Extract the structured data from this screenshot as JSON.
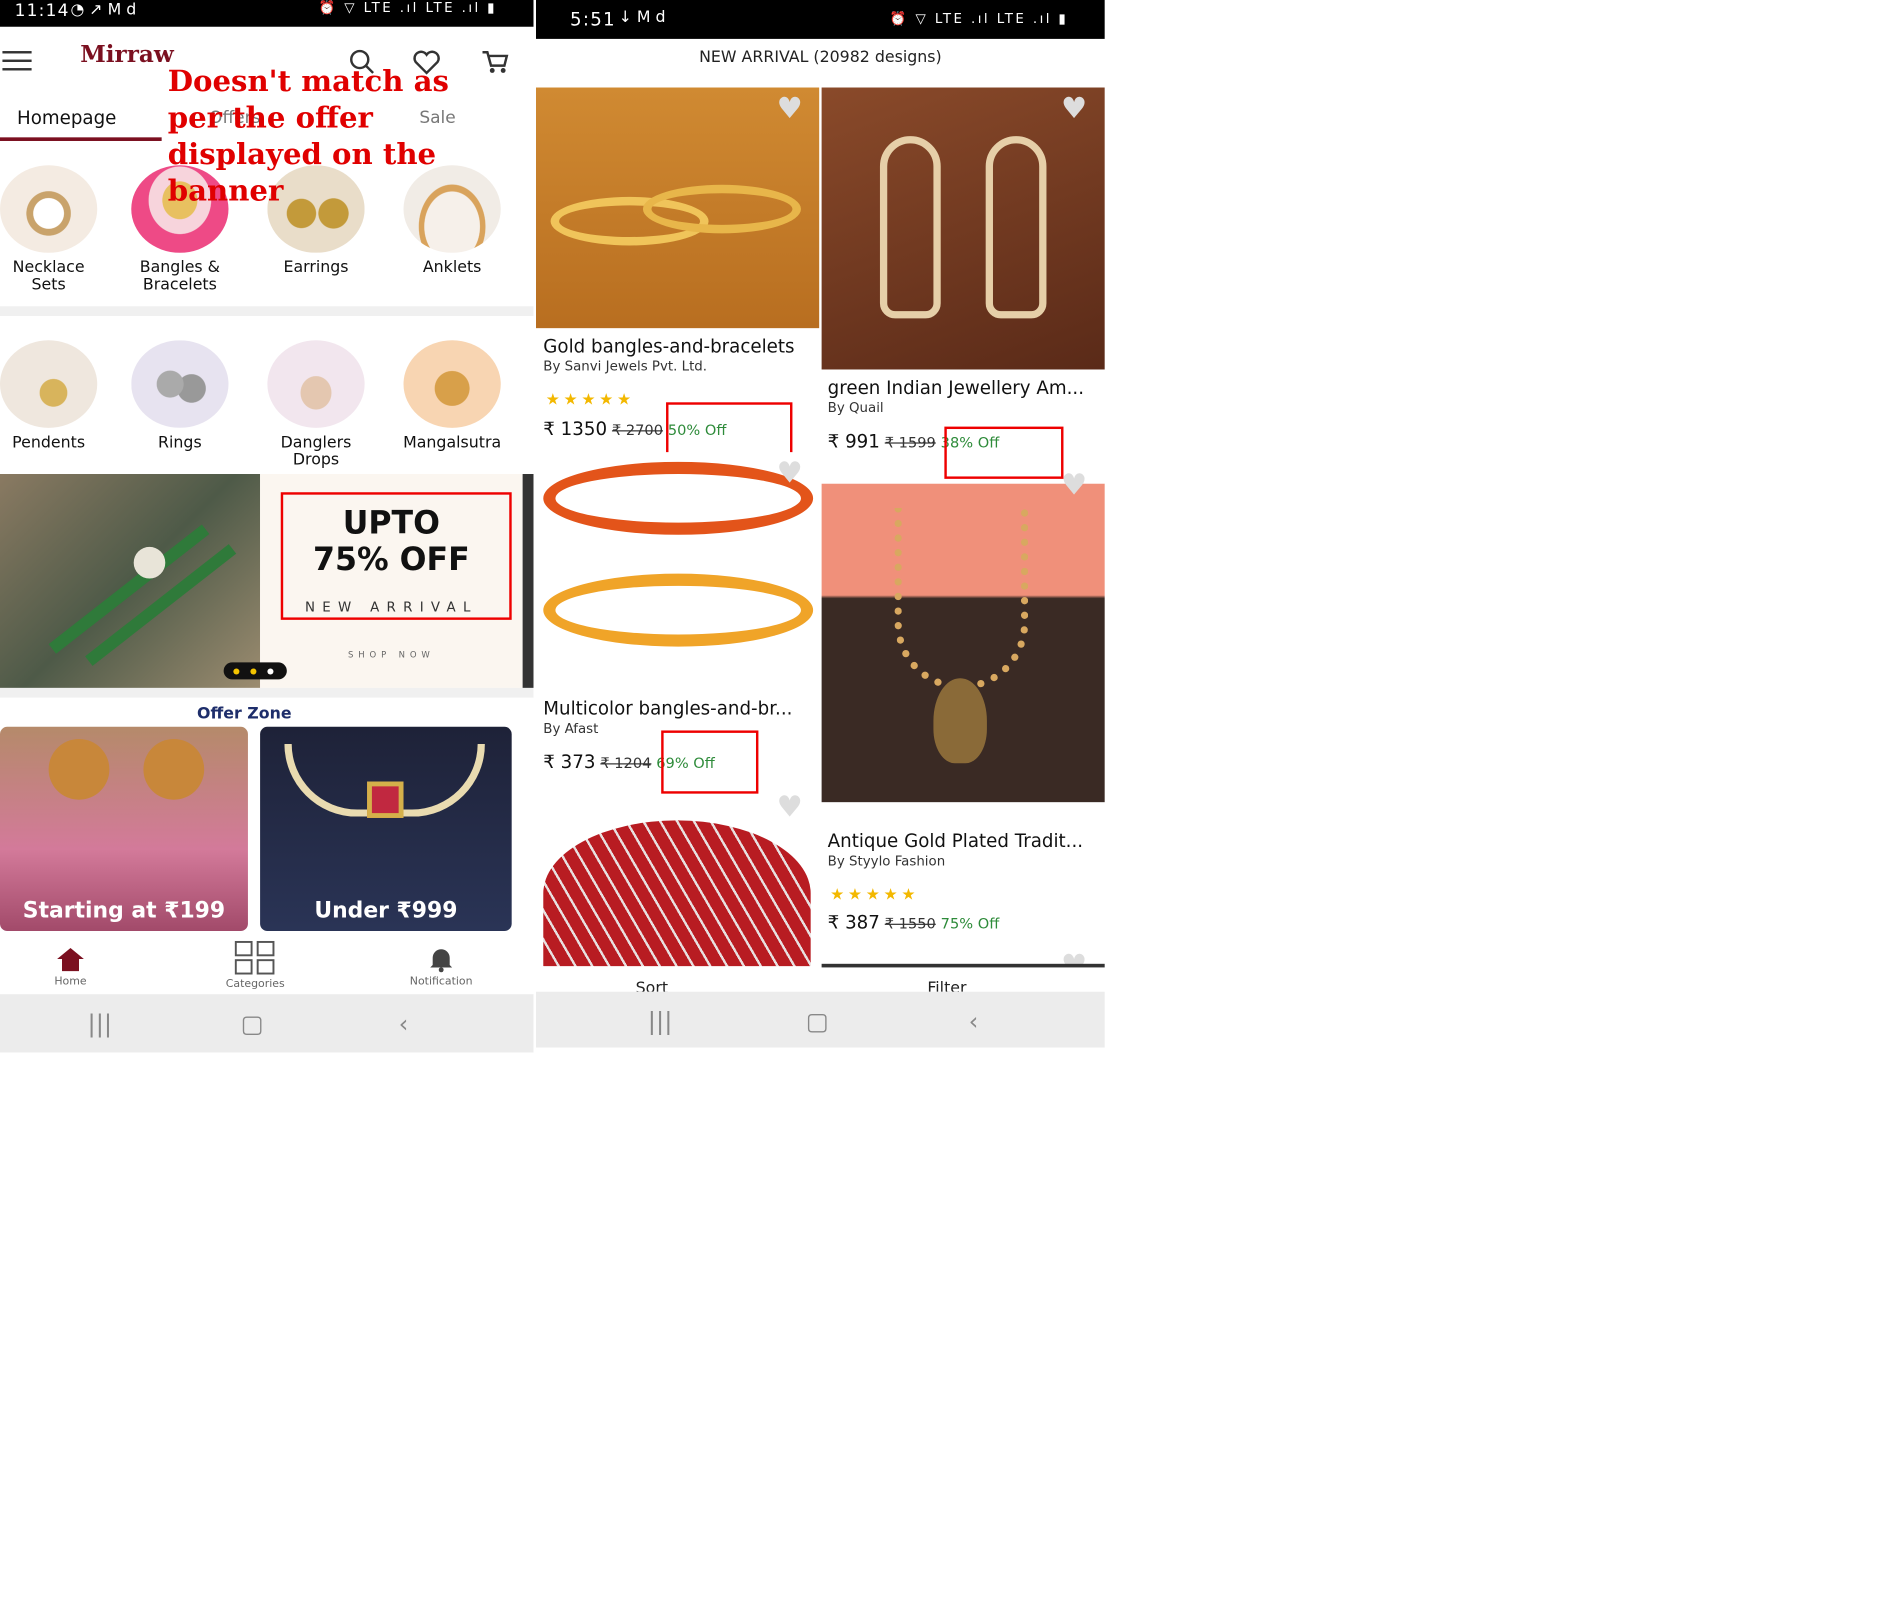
{
  "annotation": {
    "text": "Doesn't match as per the offer displayed on the banner"
  },
  "left_phone": {
    "status_time": "11:14",
    "status_icons": "◔ ↗ M d",
    "status_right": "⏰ ▽ LTE .ıl LTE .ıl ▮",
    "logo": "Mirraw",
    "tabs": {
      "homepage": "Homepage",
      "other": "Offers",
      "third": "Sale"
    },
    "categories_row1": [
      {
        "label": "Necklace Sets"
      },
      {
        "label": "Bangles & Bracelets"
      },
      {
        "label": "Earrings"
      },
      {
        "label": "Anklets"
      }
    ],
    "categories_row2": [
      {
        "label": "Pendents"
      },
      {
        "label": "Rings"
      },
      {
        "label": "Danglers Drops"
      },
      {
        "label": "Mangalsutra"
      }
    ],
    "banner": {
      "headline_1": "UPTO",
      "headline_2": "75% OFF",
      "sub": "NEW ARRIVAL",
      "cta": "SHOP NOW"
    },
    "offer_zone": {
      "title": "Offer Zone",
      "tile1": "Starting at ₹199",
      "tile2": "Under ₹999"
    },
    "bottom_tabs": [
      {
        "label": "Home"
      },
      {
        "label": "Categories"
      },
      {
        "label": "Notification"
      }
    ]
  },
  "right_phone": {
    "status_time": "5:51",
    "status_icons": "↓ M d",
    "status_right": "⏰ ▽ LTE .ıl LTE .ıl ▮",
    "header": "NEW ARRIVAL (20982 designs)",
    "products": [
      {
        "title": "Gold bangles-and-bracelets",
        "by": "By Sanvi Jewels Pvt. Ltd.",
        "price": "₹ 1350",
        "mrp": "₹ 2700",
        "off": "50% Off",
        "rated": true
      },
      {
        "title": "green Indian Jewellery Am...",
        "by": "By Quail",
        "price": "₹ 991",
        "mrp": "₹ 1599",
        "off": "38% Off",
        "rated": false
      },
      {
        "title": "Multicolor bangles-and-br...",
        "by": "By Afast",
        "price": "₹ 373",
        "mrp": "₹ 1204",
        "off": "69% Off",
        "rated": false
      },
      {
        "title": "Antique Gold Plated Tradit...",
        "by": "By Styylo Fashion",
        "price": "₹ 387",
        "mrp": "₹ 1550",
        "off": "75% Off",
        "rated": true
      }
    ],
    "bottom_partial": {
      "sort": "Sort",
      "filter": "Filter"
    }
  },
  "colors": {
    "brand": "#7b1020",
    "offer_green": "#2e8b3a",
    "annotation_red": "#e00000",
    "star": "#f3b800"
  }
}
